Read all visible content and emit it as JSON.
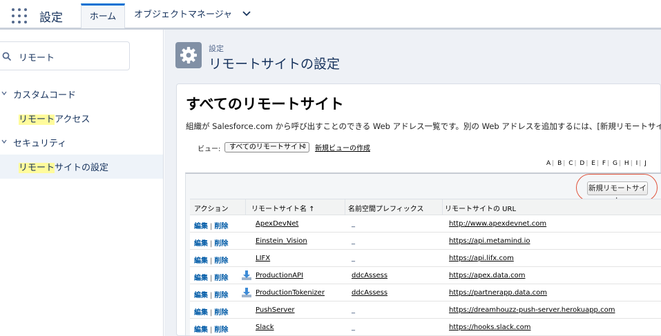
{
  "header": {
    "app_title": "設定",
    "tabs": [
      {
        "label": "ホーム",
        "active": true
      },
      {
        "label": "オブジェクトマネージャ",
        "active": false
      }
    ]
  },
  "sidebar": {
    "search_value": "リモート",
    "tree": [
      {
        "label": "カスタムコード",
        "highlight": "",
        "rest": "",
        "level": 0
      },
      {
        "label_hl": "リモート",
        "label_rest": "アクセス",
        "level": 1
      },
      {
        "label": "セキュリティ",
        "level": 0
      },
      {
        "label_hl": "リモート",
        "label_rest": "サイトの設定",
        "level": 1,
        "selected": true
      }
    ]
  },
  "page": {
    "breadcrumb": "設定",
    "title": "リモートサイトの設定"
  },
  "list": {
    "heading": "すべてのリモートサイト",
    "description": "組織が Salesforce.com から呼び出すことのできる Web アドレス一覧です。別の Web アドレスを追加するには、[新規リモートサイト] を",
    "view_label": "ビュー:",
    "view_selected": "すべてのリモートサイト",
    "new_view_link": "新規ビューの作成",
    "alpha": [
      "A",
      "B",
      "C",
      "D",
      "E",
      "F",
      "G",
      "H",
      "I",
      "J"
    ],
    "new_button": "新規リモートサイト",
    "columns": [
      "アクション",
      "リモートサイト名 ↑",
      "名前空間プレフィックス",
      "リモートサイトの URL"
    ],
    "edit_label": "編集",
    "delete_label": "削除",
    "rows": [
      {
        "name": "ApexDevNet",
        "prefix": "",
        "url": "http://www.apexdevnet.com",
        "download": false
      },
      {
        "name": "Einstein_Vision",
        "prefix": "",
        "url": "https://api.metamind.io",
        "download": false
      },
      {
        "name": "LIFX",
        "prefix": "",
        "url": "https://api.lifx.com",
        "download": false
      },
      {
        "name": "ProductionAPI",
        "prefix": "ddcAssess",
        "url": "https://apex.data.com",
        "download": true
      },
      {
        "name": "ProductionTokenizer",
        "prefix": "ddcAssess",
        "url": "https://partnerapp.data.com",
        "download": true
      },
      {
        "name": "PushServer",
        "prefix": "",
        "url": "https://dreamhouzz-push-server.herokuapp.com",
        "download": false
      },
      {
        "name": "Slack",
        "prefix": "",
        "url": "https://hooks.slack.com",
        "download": false
      }
    ]
  },
  "colors": {
    "accent": "#0070d2",
    "link_action": "#015ba7",
    "highlight_text": "#fffb9c",
    "annotation_ring": "#e05038"
  }
}
